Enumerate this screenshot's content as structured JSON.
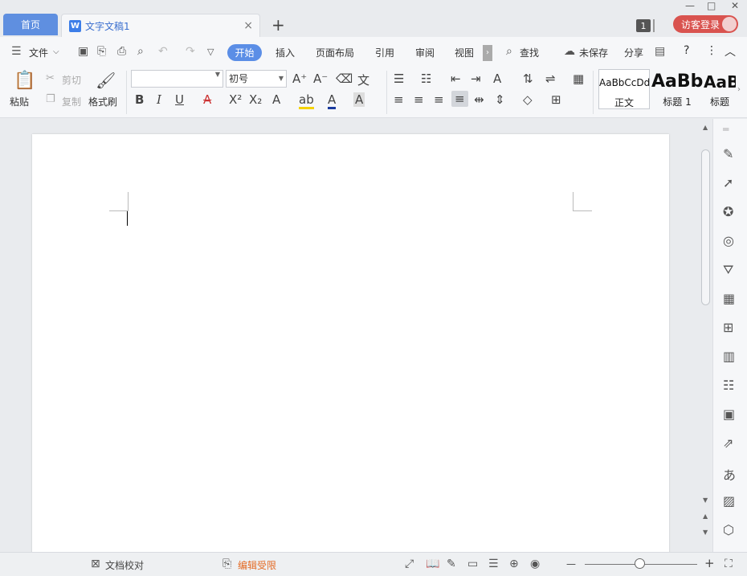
{
  "tabs": {
    "home": "首页",
    "doc_badge": "W",
    "doc": "文字文稿1",
    "close": "×",
    "add": "+"
  },
  "window": {
    "count": "1",
    "login": "访客登录",
    "minimize": "—",
    "maximize": "□",
    "close": "✕"
  },
  "menu": {
    "file": "文件",
    "tabs": [
      "开始",
      "插入",
      "页面布局",
      "引用",
      "审阅",
      "视图"
    ],
    "find": "查找",
    "unsaved": "未保存",
    "share": "分享",
    "help": "?",
    "more": "⋮",
    "collapse": "︿"
  },
  "ribbon": {
    "paste": "粘贴",
    "cut": "剪切",
    "copy": "复制",
    "format_painter": "格式刷",
    "font_name": "",
    "font_size": "初号",
    "styles": [
      {
        "preview": "AaBbCcDd",
        "label": "正文"
      },
      {
        "preview": "AaBb",
        "label": "标题 1"
      },
      {
        "preview": "AaB",
        "label": "标题"
      }
    ]
  },
  "status": {
    "proofread": "文档校对",
    "restricted": "编辑受限",
    "zoom_minus": "—",
    "zoom_plus": "+"
  }
}
